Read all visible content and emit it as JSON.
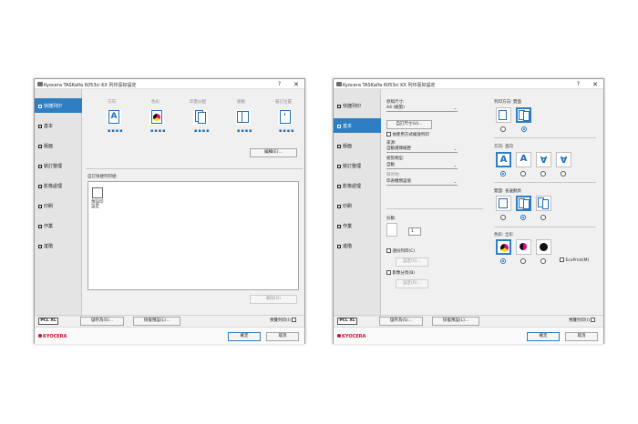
{
  "window_title": "Kyocera TASKalfa 6053ci KX 列印喜好設定",
  "help_glyph": "?",
  "close_glyph": "✕",
  "nav": [
    {
      "label": "快捷列印"
    },
    {
      "label": "基本"
    },
    {
      "label": "版面"
    },
    {
      "label": "裝訂整理"
    },
    {
      "label": "影像處理"
    },
    {
      "label": "印刷"
    },
    {
      "label": "作業"
    },
    {
      "label": "進階"
    }
  ],
  "left": {
    "quick_headers": [
      "方向",
      "色彩",
      "印量分配",
      "組數",
      "裝訂位置"
    ],
    "edit_button": "編輯(E)...",
    "profile_label": "自訂快捷列印組:",
    "profile_item": "預設印\n設定",
    "delete_button": "刪除(D)"
  },
  "right": {
    "page_size_label": "原稿尺寸:",
    "page_size_value": "A4 (紙張)",
    "custom_size_button": "自訂尺寸(U)...",
    "fit_checkbox": "依使用方式縮放列印",
    "source_label": "來源:",
    "source_value": "自動選擇紙匣",
    "media_type_label": "紙張類型:",
    "media_type_value": "自動",
    "dest_label": "目的地:",
    "dest_value": "印表機預設值",
    "copies_label": "份數:",
    "copies_value": "1",
    "collate_label": "逐份列印(C)",
    "collate_button": "設定(S)...",
    "watermark_label": "影像分頁(B)",
    "watermark_button": "設定(R)...",
    "duplex_label": "列印方向: 雙面",
    "orientation_label": "方向: 直向",
    "print_label": "雙面: 長邊翻頁",
    "color_label": "色彩: 全彩",
    "ecoprint_label": "EcoPrint(M)"
  },
  "bottom": {
    "pl_badge": "PCL XL",
    "save_button": "儲存為(S)...",
    "restore_button": "恢復預設(L)...",
    "preview_checkbox": "預覽列印(I)",
    "logo": "KYOCERA",
    "ok_button": "確定",
    "cancel_button": "取消"
  },
  "colors": {
    "accent": "#2f7ec1",
    "brand": "#c8102e",
    "sidebar": "#e4e4e4"
  }
}
